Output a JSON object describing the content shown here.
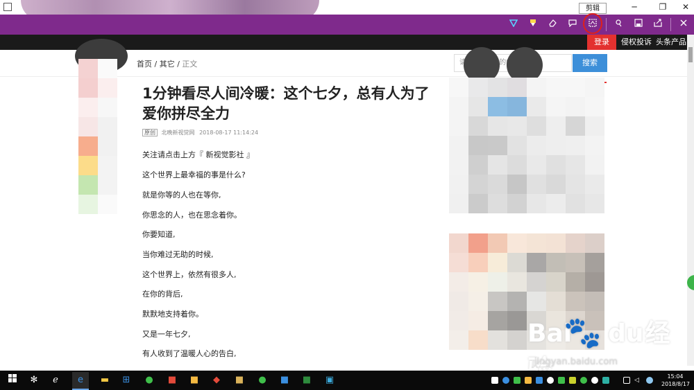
{
  "window": {
    "minimize_glyph": "─",
    "maximize_glyph": "❐",
    "close_glyph": "✕"
  },
  "ink_toolbar": {
    "tooltip": "剪辑",
    "tools": [
      "ballpoint-pen-icon",
      "highlighter-icon",
      "eraser-icon",
      "add-note-icon",
      "clip-icon",
      "touch-writing-icon",
      "save-icon",
      "share-icon",
      "exit-icon"
    ]
  },
  "site_topbar": {
    "login": "登录",
    "links": [
      "侵权投诉",
      "头条产品"
    ]
  },
  "breadcrumb": {
    "home": "首页",
    "sep1": " / ",
    "category": "其它",
    "sep2": " / ",
    "current": "正文"
  },
  "search": {
    "placeholder": "请",
    "placeholder_tail": "的内",
    "button": "搜索"
  },
  "article": {
    "title": "1分钟看尽人间冷暖：这个七夕，总有人为了爱你拼尽全力",
    "tag": "原创",
    "source": "北晚新视觉网",
    "time": "2018-08-17 11:14:24",
    "paragraphs": [
      "关注请点击上方『 新视觉影社 』",
      "这个世界上最幸福的事是什么?",
      "就是你等的人也在等你,",
      "你思念的人，也在思念着你。",
      "你要知道,",
      "当你难过无助的时候,",
      "这个世界上，依然有很多人,",
      "在你的背后,",
      "默默地支持着你。",
      "又是一年七夕,",
      "有人收到了温暖人心的告白,"
    ]
  },
  "watermark": {
    "brand": "Bai",
    "brand2": "du",
    "cn": "经验",
    "url": "jingyan.baidu.com"
  },
  "taskbar": {
    "time": "15:04",
    "date": "2018/8/17"
  },
  "colors": {
    "ink_toolbar": "#7f2a8c",
    "login_red": "#e3312f",
    "search_blue": "#3d8fd9",
    "annotation_red": "#e0201a"
  }
}
